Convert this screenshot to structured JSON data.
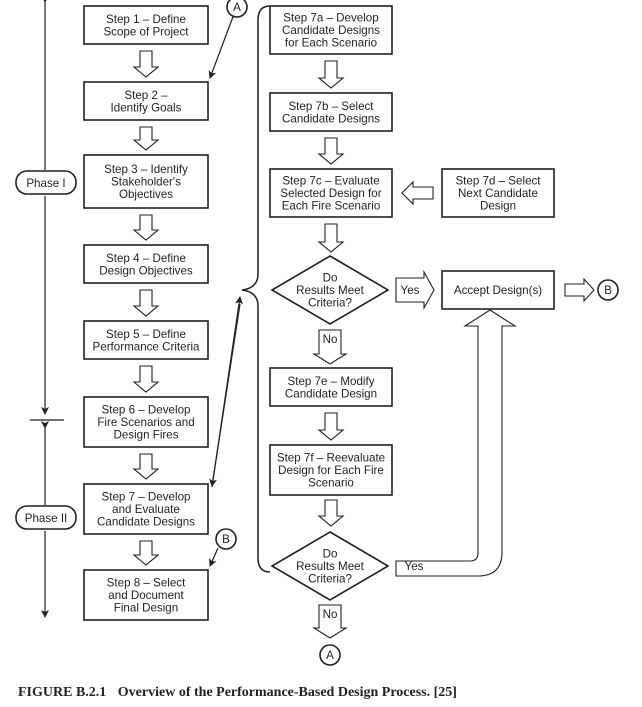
{
  "figure": {
    "caption_label": "FIGURE B.2.1",
    "caption_text": "Overview of the Performance-Based Design Process. [25]"
  },
  "phases": [
    {
      "label": "Phase I"
    },
    {
      "label": "Phase II"
    }
  ],
  "steps": {
    "s1": [
      "Step 1 – Define",
      "Scope of Project"
    ],
    "s2": [
      "Step 2 –",
      "Identify Goals"
    ],
    "s3": [
      "Step 3 – Identify",
      "Stakeholder's",
      "Objectives"
    ],
    "s4": [
      "Step 4 – Define",
      "Design Objectives"
    ],
    "s5": [
      "Step 5 – Define",
      "Performance Criteria"
    ],
    "s6": [
      "Step 6 – Develop",
      "Fire Scenarios and",
      "Design Fires"
    ],
    "s7": [
      "Step 7 – Develop",
      "and Evaluate",
      "Candidate Designs"
    ],
    "s8": [
      "Step 8 – Select",
      "and Document",
      "Final Design"
    ],
    "s7a": [
      "Step 7a – Develop",
      "Candidate Designs",
      "for Each Scenario"
    ],
    "s7b": [
      "Step 7b – Select",
      "Candidate Designs"
    ],
    "s7c": [
      "Step 7c – Evaluate",
      "Selected Design for",
      "Each Fire Scenario"
    ],
    "s7d": [
      "Step 7d – Select",
      "Next Candidate",
      "Design"
    ],
    "s7e": [
      "Step 7e – Modify",
      "Candidate Design"
    ],
    "s7f": [
      "Step 7f – Reevaluate",
      "Design for Each Fire",
      "Scenario"
    ],
    "accept": [
      "Accept Design(s)"
    ]
  },
  "decisions": {
    "d1": [
      "Do",
      "Results Meet",
      "Criteria?"
    ],
    "d2": [
      "Do",
      "Results Meet",
      "Criteria?"
    ]
  },
  "labels": {
    "yes": "Yes",
    "no": "No"
  },
  "connectors": {
    "a": "A",
    "b": "B"
  }
}
